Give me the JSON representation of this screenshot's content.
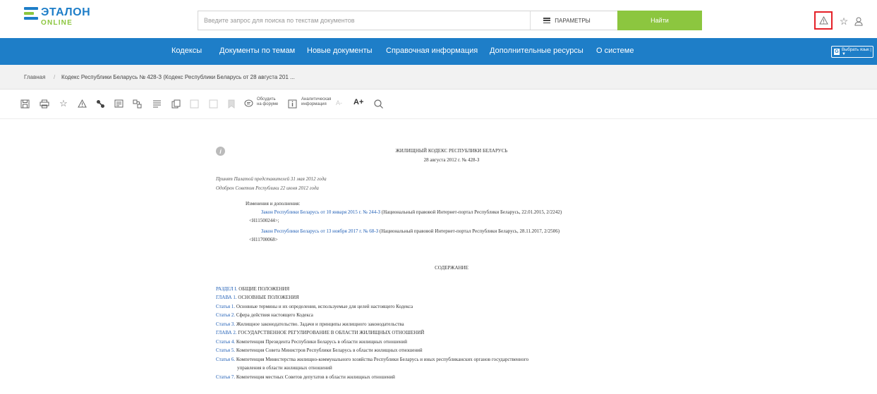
{
  "header": {
    "logo_main": "ЭТАЛОН",
    "logo_sub": "ONLINE",
    "search_placeholder": "Введите запрос для поиска по текстам документов",
    "params_label": "ПАРАМЕТРЫ",
    "find_label": "Найти",
    "icons": [
      "warning-icon",
      "star-icon",
      "user-icon"
    ]
  },
  "nav": {
    "items": [
      "Кодексы",
      "Документы по темам",
      "Новые документы",
      "Справочная информация",
      "Дополнительные ресурсы",
      "О системе"
    ],
    "lang_label": "Выбрать язык | ▼"
  },
  "breadcrumb": {
    "home": "Главная",
    "separator": "/",
    "current": "Кодекс Республики Беларусь № 428-З (Кодекс Республики Беларусь от 28 августа 201 ..."
  },
  "toolbar": {
    "forum_line1": "Обсудить",
    "forum_line2": "на форуме",
    "analytic_line1": "Аналитическая",
    "analytic_line2": "информация",
    "font_small": "A-",
    "font_large": "A+"
  },
  "document": {
    "title": "ЖИЛИЩНЫЙ КОДЕКС РЕСПУБЛИКИ БЕЛАРУСЬ",
    "date_line": "28 августа 2012 г. № 428-З",
    "adopted_line1": "Принят Палатой представителей 31 мая 2012 года",
    "adopted_line2": "Одобрен Советом Республики 22 июня 2012 года",
    "changes_header": "Изменения и дополнения:",
    "change1_link": "Закон Республики Беларусь от 10 января 2015 г. № 244-З",
    "change1_text": " (Национальный правовой Интернет-портал Республики Беларусь, 22.01.2015, 2/2242)",
    "change1_code": "<H11500244>;",
    "change2_link": "Закон Республики Беларусь от 13 ноября 2017 г. № 68-З",
    "change2_text": " (Национальный правовой Интернет-портал Республики Беларусь, 28.11.2017, 2/2506)",
    "change2_code": "<H11700068>",
    "contents_title": "СОДЕРЖАНИЕ",
    "toc": [
      {
        "link": "РАЗДЕЛ I.",
        "text": " ОБЩИЕ ПОЛОЖЕНИЯ"
      },
      {
        "link": "ГЛАВА 1.",
        "text": " ОСНОВНЫЕ ПОЛОЖЕНИЯ"
      },
      {
        "link": "Статья 1.",
        "text": " Основные термины и их определения, используемые для целей настоящего Кодекса"
      },
      {
        "link": "Статья 2.",
        "text": " Сфера действия настоящего Кодекса"
      },
      {
        "link": "Статья 3.",
        "text": " Жилищное законодательство. Задачи и принципы жилищного законодательства"
      },
      {
        "link": "ГЛАВА 2.",
        "text": " ГОСУДАРСТВЕННОЕ РЕГУЛИРОВАНИЕ В ОБЛАСТИ ЖИЛИЩНЫХ ОТНОШЕНИЙ"
      },
      {
        "link": "Статья 4.",
        "text": " Компетенция Президента Республики Беларусь в области жилищных отношений"
      },
      {
        "link": "Статья 5.",
        "text": " Компетенция Совета Министров Республики Беларусь в области жилищных отношений"
      },
      {
        "link": "Статья 6.",
        "text": " Компетенция Министерства жилищно-коммунального хозяйства Республики Беларусь и иных республиканских органов государственного"
      },
      {
        "link": "",
        "text": "управления в области жилищных отношений"
      },
      {
        "link": "Статья 7.",
        "text": " Компетенция местных Советов депутатов в области жилищных отношений"
      }
    ]
  },
  "colors": {
    "brand_blue": "#1e7ec8",
    "brand_green": "#8cc63f",
    "alert_red": "#e52128",
    "link_blue": "#1e5db5"
  }
}
